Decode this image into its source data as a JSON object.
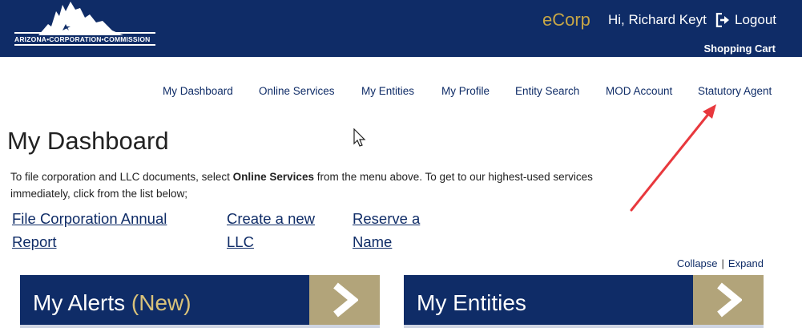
{
  "header": {
    "logo_text": "ARIZONA•CORPORATION•COMMISSION",
    "brand": "eCorp",
    "greeting": "Hi, Richard Keyt",
    "logout_label": "Logout",
    "cart_label": "Shopping Cart"
  },
  "nav": {
    "items": [
      {
        "label": "My Dashboard"
      },
      {
        "label": "Online Services"
      },
      {
        "label": "My Entities"
      },
      {
        "label": "My Profile"
      },
      {
        "label": "Entity Search"
      },
      {
        "label": "MOD Account"
      },
      {
        "label": "Statutory Agent"
      }
    ]
  },
  "main": {
    "title": "My Dashboard",
    "intro_before": "To file corporation and LLC documents, select ",
    "intro_bold": "Online Services",
    "intro_after": " from the menu above. To get to our highest-used services immediately, click from the list below;",
    "quick_links": [
      {
        "label": "File Corporation Annual Report"
      },
      {
        "label": "Create a new LLC"
      },
      {
        "label": "Reserve a Name"
      }
    ],
    "collapse_label": "Collapse",
    "separator": "|",
    "expand_label": "Expand"
  },
  "panels": {
    "alerts_title": "My Alerts",
    "alerts_badge": "(New)",
    "entities_title": "My Entities"
  },
  "colors": {
    "header_bg": "#0f2c67",
    "brand_gold": "#c7a646",
    "panel_button": "#b2a47a",
    "annotation_red": "#e8383d"
  }
}
